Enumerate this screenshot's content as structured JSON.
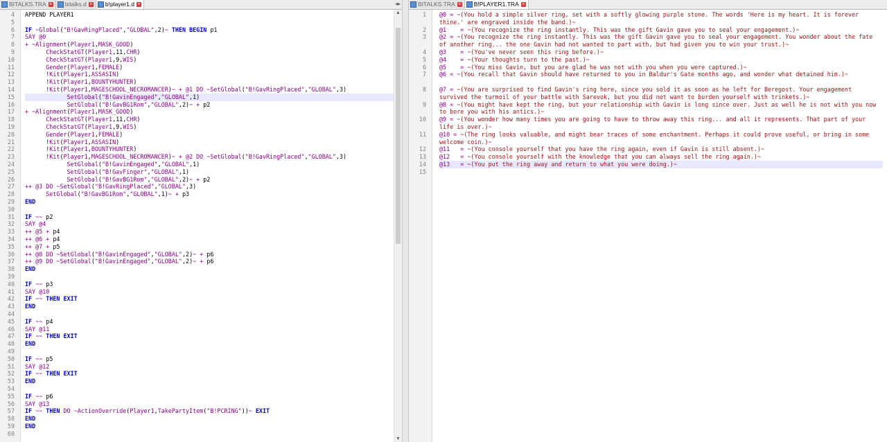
{
  "left_pane": {
    "tabs": [
      {
        "label": "BITALKS.TRA",
        "active": false
      },
      {
        "label": "bitalks.d",
        "active": false
      },
      {
        "label": "b!player1.d",
        "active": true
      }
    ],
    "line_numbers": [
      "4",
      "5",
      "6",
      "7",
      "8",
      "9",
      "10",
      "11",
      "12",
      "13",
      "14",
      "15",
      "16",
      "17",
      "18",
      "19",
      "20",
      "21",
      "22",
      "23",
      "24",
      "25",
      "26",
      "27",
      "28",
      "29",
      "30",
      "31",
      "32",
      "33",
      "34",
      "35",
      "36",
      "37",
      "38",
      "39",
      "40",
      "41",
      "42",
      "43",
      "44",
      "45",
      "46",
      "47",
      "48",
      "49",
      "50",
      "51",
      "52",
      "53",
      "54",
      "55",
      "56",
      "57",
      "58",
      "59",
      "60"
    ],
    "highlighted_line": "15",
    "code": [
      "APPEND PLAYER1",
      "",
      "IF ~Global(\"B!GavRingPlaced\",\"GLOBAL\",2)~ THEN BEGIN p1",
      "SAY @0",
      "+ ~Alignment(Player1,MASK_GOOD)",
      "      CheckStatGT(Player1,11,CHR)",
      "      CheckStatGT(Player1,9,WIS)",
      "      Gender(Player1,FEMALE)",
      "      !Kit(Player1,ASSASIN)",
      "      !Kit(Player1,BOUNTYHUNTER)",
      "      !Kit(Player1,MAGESCHOOL_NECROMANCER)~ + @1 DO ~SetGlobal(\"B!GavRingPlaced\",\"GLOBAL\",3)",
      "            SetGlobal(\"B!GavinEngaged\",\"GLOBAL\",1)",
      "            SetGlobal(\"B!GavBG1Rom\",\"GLOBAL\",2)~ + p2",
      "+ ~Alignment(Player1,MASK_GOOD)",
      "      CheckStatGT(Player1,11,CHR)",
      "      CheckStatGT(Player1,9,WIS)",
      "      Gender(Player1,FEMALE)",
      "      !Kit(Player1,ASSASIN)",
      "      !Kit(Player1,BOUNTYHUNTER)",
      "      !Kit(Player1,MAGESCHOOL_NECROMANCER)~ + @2 DO ~SetGlobal(\"B!GavRingPlaced\",\"GLOBAL\",3)",
      "            SetGlobal(\"B!GavinEngaged\",\"GLOBAL\",1)",
      "            SetGlobal(\"B!GavFinger\",\"GLOBAL\",1)",
      "            SetGlobal(\"B!GavBG1Rom\",\"GLOBAL\",2)~ + p2",
      "++ @3 DO ~SetGlobal(\"B!GavRingPlaced\",\"GLOBAL\",3)",
      "      SetGlobal(\"B!GavBG1Rom\",\"GLOBAL\",1)~ + p3",
      "END",
      "",
      "IF ~~ p2",
      "SAY @4",
      "++ @5 + p4",
      "++ @6 + p4",
      "++ @7 + p5",
      "++ @8 DO ~SetGlobal(\"B!GavinEngaged\",\"GLOBAL\",2)~ + p6",
      "++ @9 DO ~SetGlobal(\"B!GavinEngaged\",\"GLOBAL\",2)~ + p6",
      "END",
      "",
      "IF ~~ p3",
      "SAY @10",
      "IF ~~ THEN EXIT",
      "END",
      "",
      "IF ~~ p4",
      "SAY @11",
      "IF ~~ THEN EXIT",
      "END",
      "",
      "IF ~~ p5",
      "SAY @12",
      "IF ~~ THEN EXIT",
      "END",
      "",
      "IF ~~ p6",
      "SAY @13",
      "IF ~~ THEN DO ~ActionOverride(Player1,TakePartyItem(\"B!PCRING\"))~ EXIT",
      "END",
      "END",
      ""
    ]
  },
  "right_pane": {
    "tabs": [
      {
        "label": "BITALKS.TRA",
        "active": false
      },
      {
        "label": "B!PLAYER1.TRA",
        "active": true
      }
    ],
    "line_numbers": [
      "1",
      "2",
      "3",
      "4",
      "5",
      "6",
      "7",
      "8",
      "9",
      "10",
      "11",
      "12",
      "13",
      "14",
      "15"
    ],
    "highlighted_line": "14",
    "entries": [
      {
        "ref": "@0",
        "text": "~(You hold a simple silver ring, set with a softly glowing purple stone. The words 'Here is my heart. It is forever thine.' are engraved inside the band.)~"
      },
      {
        "ref": "@1",
        "text": "~(You recognize the ring instantly. This was the gift Gavin gave you to seal your engagement.)~"
      },
      {
        "ref": "@2",
        "text": "~(You recognize the ring instantly. This was the gift Gavin gave you to seal your engagement. You wonder about the fate of another ring... the one Gavin had not wanted to part with, but had given you to win your trust.)~"
      },
      {
        "ref": "@3",
        "text": "~(You've never seen this ring before.)~"
      },
      {
        "ref": "@4",
        "text": "~(Your thoughts turn to the past.)~"
      },
      {
        "ref": "@5",
        "text": "~(You miss Gavin, but you are glad he was not with you when you were captured.)~"
      },
      {
        "ref": "@6",
        "text": "~(You recall that Gavin should have returned to you in Baldur's Gate months ago, and wonder what detained him.)~"
      },
      {
        "ref": "@7",
        "text": "~(You are surprised to find Gavin's ring here, since you sold it as soon as he left for Beregost. Your engagement survived the turmoil of your battle with Sarevok, but you did not want to burden yourself with trinkets.)~"
      },
      {
        "ref": "@8",
        "text": "~(You might have kept the ring, but your relationship with Gavin is long since over. Just as well he is not with you now to bore you with his antics.)~"
      },
      {
        "ref": "@9",
        "text": "~(You wonder how many times you are going to have to throw away this ring... and all it represents. That part of your life is over.)~"
      },
      {
        "ref": "@10",
        "text": "~(The ring looks valuable, and might bear traces of some enchantment. Perhaps it could prove useful, or bring in some welcome coin.)~"
      },
      {
        "ref": "@11",
        "text": "~(You console yourself that you have the ring again, even if Gavin is still absent.)~"
      },
      {
        "ref": "@12",
        "text": "~(You console yourself with the knowledge that you can always sell the ring again.)~"
      },
      {
        "ref": "@13",
        "text": "~(You put the ring away and return to what you were doing.)~"
      }
    ]
  },
  "icons": {
    "file": "file-icon",
    "close": "close-icon",
    "scroll_up": "arrow-up-icon",
    "scroll_down": "arrow-down-icon"
  },
  "colors": {
    "keyword": "#0000c0",
    "string": "#8b008b",
    "tra_text": "#a31515",
    "highlight": "#e8e8ff",
    "close_button": "#d23c3c"
  }
}
